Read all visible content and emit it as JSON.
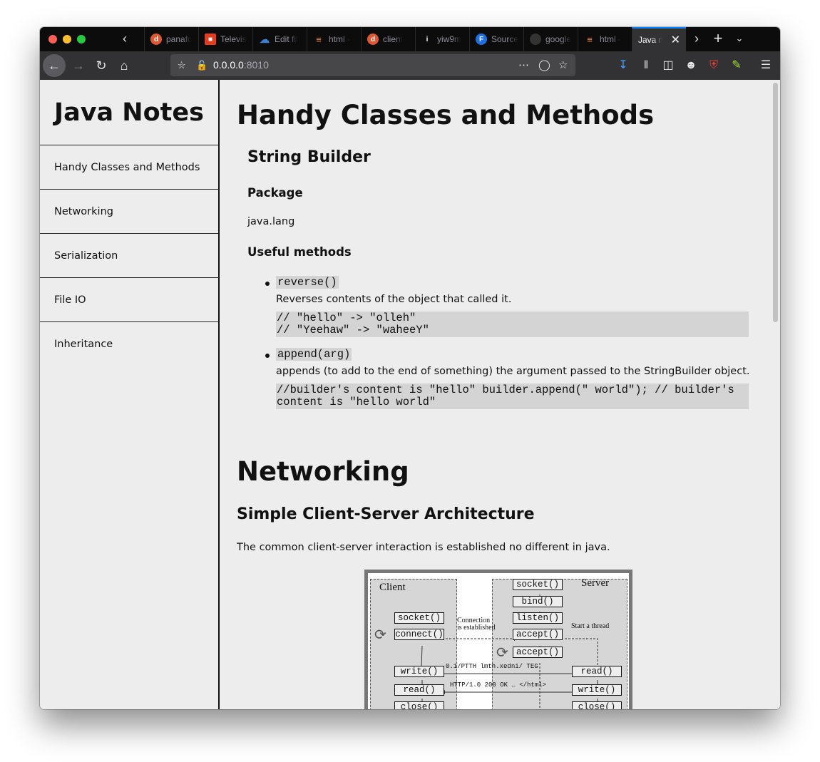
{
  "browser": {
    "tabs": [
      {
        "title": "panafc",
        "icon": "duckduckgo-icon",
        "color": "#de5833"
      },
      {
        "title": "Televis",
        "icon": "tv-icon",
        "color": "#e53c1f"
      },
      {
        "title": "Edit fil",
        "icon": "cloud-icon",
        "color": "#3c7fd6"
      },
      {
        "title": "html -",
        "icon": "stackoverflow-icon",
        "color": "#f48024"
      },
      {
        "title": "client",
        "icon": "duckduckgo-icon",
        "color": "#de5833"
      },
      {
        "title": "yiw9m",
        "icon": "info-icon",
        "color": "#ffffff"
      },
      {
        "title": "Source",
        "icon": "f-icon",
        "color": "#1e6fe0"
      },
      {
        "title": "google",
        "icon": "github-icon",
        "color": "#333333"
      },
      {
        "title": "html -",
        "icon": "stackoverflow-icon",
        "color": "#f48024"
      },
      {
        "title": "Java no",
        "icon": "",
        "color": ""
      }
    ],
    "fav_letters": {
      "f": "F",
      "info": "i"
    },
    "url": {
      "host": "0.0.0.0",
      "port": ":8010"
    }
  },
  "sidebar": {
    "brand": "Java Notes",
    "items": [
      "Handy Classes and Methods",
      "Networking",
      "Serialization",
      "File IO",
      "Inheritance"
    ]
  },
  "main": {
    "section1": {
      "title": "Handy Classes and Methods",
      "subtitle": "String Builder",
      "package_heading": "Package",
      "package_name": "java.lang",
      "methods_heading": "Useful methods",
      "methods": [
        {
          "name": "reverse()",
          "desc": "Reverses contents of the object that called it.",
          "code_lines": [
            "// \"hello\" -> \"olleh\"",
            "// \"Yeehaw\" -> \"waheeY\""
          ]
        },
        {
          "name": "append(arg)",
          "desc": "appends (to add to the end of something) the argument passed to the StringBuilder object.",
          "code_lines": [
            "//builder's content is \"hello\" builder.append(\" world\"); // builder's",
            "content is \"hello world\""
          ]
        }
      ]
    },
    "section2": {
      "title": "Networking",
      "subtitle": "Simple Client-Server Architecture",
      "intro": "The common client-server interaction is established no different in java.",
      "diagram": {
        "client_label": "Client",
        "server_label": "Server",
        "client_boxes": [
          "socket()",
          "connect()",
          "write()",
          "read()",
          "close()"
        ],
        "server_boxes": [
          "socket()",
          "bind()",
          "listen()",
          "accept()",
          "accept()",
          "read()",
          "write()",
          "close()"
        ],
        "connection_note_1": "Connection",
        "connection_note_2": "is established",
        "thread_note": "Start a thread",
        "request_msg": "0.1/PTTH lmth.xedni/ TEG",
        "response_msg": "HTTP/1.0 200 OK … </html>"
      }
    }
  }
}
